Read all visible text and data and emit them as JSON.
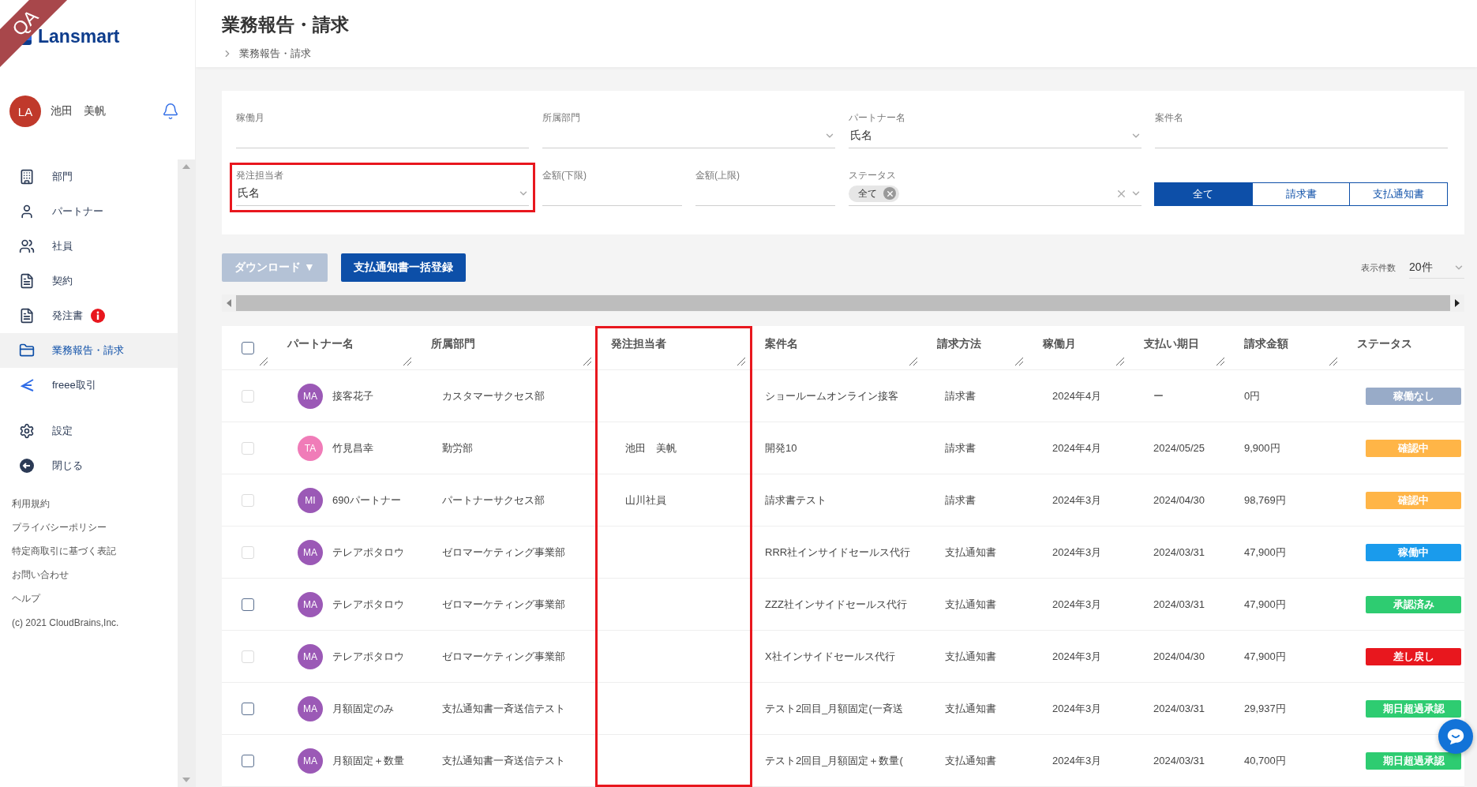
{
  "ribbon": {
    "label": "QA"
  },
  "logo": {
    "text": "Lansmart"
  },
  "user": {
    "initials": "LA",
    "name": "池田　美帆"
  },
  "nav": [
    {
      "label": "部門",
      "selected": false,
      "alert": false
    },
    {
      "label": "パートナー",
      "selected": false,
      "alert": false
    },
    {
      "label": "社員",
      "selected": false,
      "alert": false
    },
    {
      "label": "契約",
      "selected": false,
      "alert": false
    },
    {
      "label": "発注書",
      "selected": false,
      "alert": true
    },
    {
      "label": "業務報告・請求",
      "selected": true,
      "alert": false
    },
    {
      "label": "freee取引",
      "selected": false,
      "alert": false
    },
    {
      "label": "設定",
      "selected": false,
      "alert": false
    },
    {
      "label": "閉じる",
      "selected": false,
      "alert": false
    }
  ],
  "footer_links": [
    "利用規約",
    "プライバシーポリシー",
    "特定商取引に基づく表記",
    "お問い合わせ",
    "ヘルプ"
  ],
  "copyright": "(c) 2021 CloudBrains,Inc.",
  "page": {
    "title": "業務報告・請求",
    "breadcrumb": [
      "業務報告・請求"
    ]
  },
  "filters": [
    {
      "kind": "text",
      "label": "稼働月",
      "highlighted": false
    },
    {
      "kind": "select",
      "label": "所属部門",
      "highlighted": false
    },
    {
      "kind": "select",
      "label": "パートナー名",
      "value": "氏名",
      "highlighted": false
    },
    {
      "kind": "text",
      "label": "案件名",
      "highlighted": false
    },
    {
      "kind": "select",
      "label": "発注担当者",
      "value": "氏名",
      "highlighted": true
    },
    {
      "kind": "amount",
      "label": "金額(下限)",
      "highlighted": false
    },
    {
      "kind": "amount",
      "label": "金額(上限)",
      "highlighted": false
    },
    {
      "kind": "tags",
      "label": "ステータス",
      "tags": [
        "全て"
      ],
      "highlighted": false
    },
    {
      "kind": "segments",
      "highlighted": false,
      "options": [
        {
          "label": "全て",
          "selected": true
        },
        {
          "label": "請求書",
          "selected": false
        },
        {
          "label": "支払通知書",
          "selected": false
        }
      ]
    }
  ],
  "toolbar": {
    "download": {
      "label": "ダウンロード ▼",
      "disabled": true
    },
    "bulk": {
      "label": "支払通知書一括登録",
      "disabled": false
    },
    "page_size": {
      "label": "表示件数",
      "value": "20件"
    }
  },
  "table": {
    "select_all": {
      "checked": false
    },
    "columns": [
      {
        "label": "パートナー名",
        "highlighted": false
      },
      {
        "label": "所属部門",
        "highlighted": false
      },
      {
        "label": "発注担当者",
        "highlighted": true
      },
      {
        "label": "案件名",
        "highlighted": false
      },
      {
        "label": "請求方法",
        "highlighted": false
      },
      {
        "label": "稼働月",
        "highlighted": false
      },
      {
        "label": "支払い期日",
        "highlighted": false
      },
      {
        "label": "請求金額",
        "highlighted": false
      },
      {
        "label": "ステータス",
        "highlighted": false
      }
    ],
    "rows": [
      {
        "checked": false,
        "disabled": true,
        "initials": "MA",
        "color": "#9b59b6",
        "partner": "接客花子",
        "department": "カスタマーサクセス部",
        "orderer": "",
        "project": "ショールームオンライン接客",
        "method": "請求書",
        "month": "2024年4月",
        "due": "ー",
        "amount": "0円",
        "status": {
          "label": "稼働なし",
          "color": "#98abc8"
        }
      },
      {
        "checked": false,
        "disabled": true,
        "initials": "TA",
        "color": "#f07cb8",
        "partner": "竹見昌幸",
        "department": "勤労部",
        "orderer": "池田　美帆",
        "project": "開発10",
        "method": "請求書",
        "month": "2024年4月",
        "due": "2024/05/25",
        "amount": "9,900円",
        "status": {
          "label": "確認中",
          "color": "#ffb547"
        }
      },
      {
        "checked": false,
        "disabled": true,
        "initials": "MI",
        "color": "#9b59b6",
        "partner": "690パートナー",
        "department": "パートナーサクセス部",
        "orderer": "山川社員",
        "project": "請求書テスト",
        "method": "請求書",
        "month": "2024年3月",
        "due": "2024/04/30",
        "amount": "98,769円",
        "status": {
          "label": "確認中",
          "color": "#ffb547"
        }
      },
      {
        "checked": false,
        "disabled": true,
        "initials": "MA",
        "color": "#9b59b6",
        "partner": "テレアポタロウ",
        "department": "ゼロマーケティング事業部",
        "orderer": "",
        "project": "RRR社インサイドセールス代行",
        "method": "支払通知書",
        "month": "2024年3月",
        "due": "2024/03/31",
        "amount": "47,900円",
        "status": {
          "label": "稼働中",
          "color": "#1a9bec"
        }
      },
      {
        "checked": false,
        "disabled": false,
        "initials": "MA",
        "color": "#9b59b6",
        "partner": "テレアポタロウ",
        "department": "ゼロマーケティング事業部",
        "orderer": "",
        "project": "ZZZ社インサイドセールス代行",
        "method": "支払通知書",
        "month": "2024年3月",
        "due": "2024/03/31",
        "amount": "47,900円",
        "status": {
          "label": "承認済み",
          "color": "#2ecc71"
        }
      },
      {
        "checked": false,
        "disabled": true,
        "initials": "MA",
        "color": "#9b59b6",
        "partner": "テレアポタロウ",
        "department": "ゼロマーケティング事業部",
        "orderer": "",
        "project": "X社インサイドセールス代行",
        "method": "支払通知書",
        "month": "2024年3月",
        "due": "2024/04/30",
        "amount": "47,900円",
        "status": {
          "label": "差し戻し",
          "color": "#e8171e"
        }
      },
      {
        "checked": false,
        "disabled": false,
        "initials": "MA",
        "color": "#9b59b6",
        "partner": "月額固定のみ",
        "department": "支払通知書一斉送信テスト",
        "orderer": "",
        "project": "テスト2回目_月額固定(一斉送",
        "method": "支払通知書",
        "month": "2024年3月",
        "due": "2024/03/31",
        "amount": "29,937円",
        "status": {
          "label": "期日超過承認",
          "color": "#2ecc71"
        }
      },
      {
        "checked": false,
        "disabled": false,
        "initials": "MA",
        "color": "#9b59b6",
        "partner": "月額固定＋数量",
        "department": "支払通知書一斉送信テスト",
        "orderer": "",
        "project": "テスト2回目_月額固定＋数量(",
        "method": "支払通知書",
        "month": "2024年3月",
        "due": "2024/03/31",
        "amount": "40,700円",
        "status": {
          "label": "期日超過承認",
          "color": "#2ecc71"
        }
      }
    ]
  }
}
